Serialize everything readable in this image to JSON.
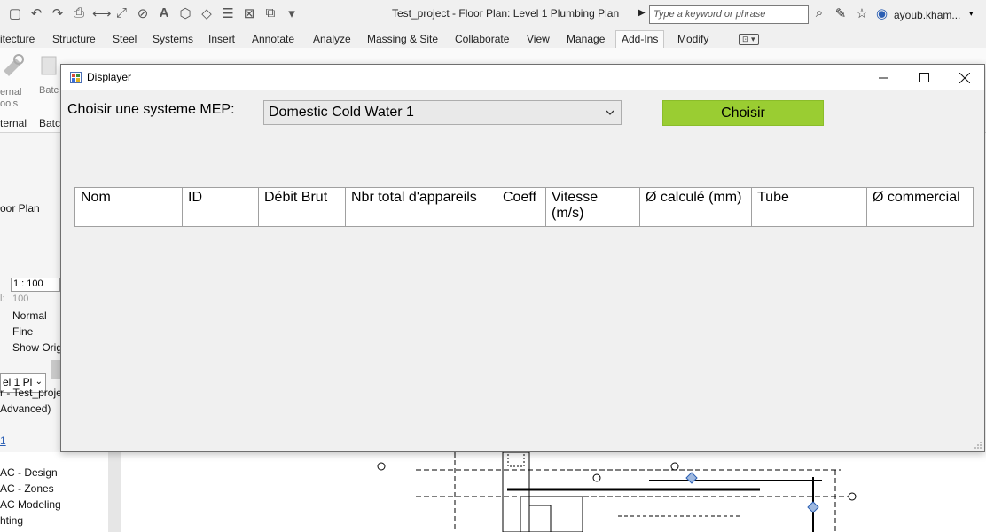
{
  "app": {
    "title": "Test_project - Floor Plan: Level 1 Plumbing Plan",
    "search_placeholder": "Type a keyword or phrase",
    "user": "ayoub.kham...",
    "ribbon_tabs": [
      "itecture",
      "Structure",
      "Steel",
      "Systems",
      "Insert",
      "Annotate",
      "Analyze",
      "Massing & Site",
      "Collaborate",
      "View",
      "Manage",
      "Add-Ins",
      "Modify"
    ],
    "active_tab": "Add-Ins",
    "ribbon_labels": {
      "external_tools": "ernal\nools",
      "batch_top": "Batc",
      "external_group": "ternal",
      "batch_group": "Batc"
    }
  },
  "left_panel": {
    "view_name": "oor Plan",
    "view_dropdown": "el 1 Pl",
    "scale": "1 : 100",
    "scale_value_label": "l:",
    "scale_value": "100",
    "display_model": "Normal",
    "detail_level": "Fine",
    "parts_visibility": "Show Orig",
    "browser_title": "r - Test_projec",
    "browser_advanced": "Advanced)",
    "browser_link": "1",
    "browser_items": [
      "AC - Design",
      "AC - Zones",
      "AC Modeling",
      "hting"
    ]
  },
  "dialog": {
    "title": "Displayer",
    "mep_label": "Choisir une systeme MEP:",
    "mep_selected": "Domestic Cold Water 1",
    "choose_button": "Choisir",
    "choose_button_color": "#9acd32",
    "columns": [
      "Nom",
      "ID",
      "Débit Brut",
      "Nbr total d'appareils",
      "Coeff",
      "Vitesse (m/s)",
      "Ø calculé (mm)",
      "Tube",
      "Ø commercial"
    ]
  }
}
